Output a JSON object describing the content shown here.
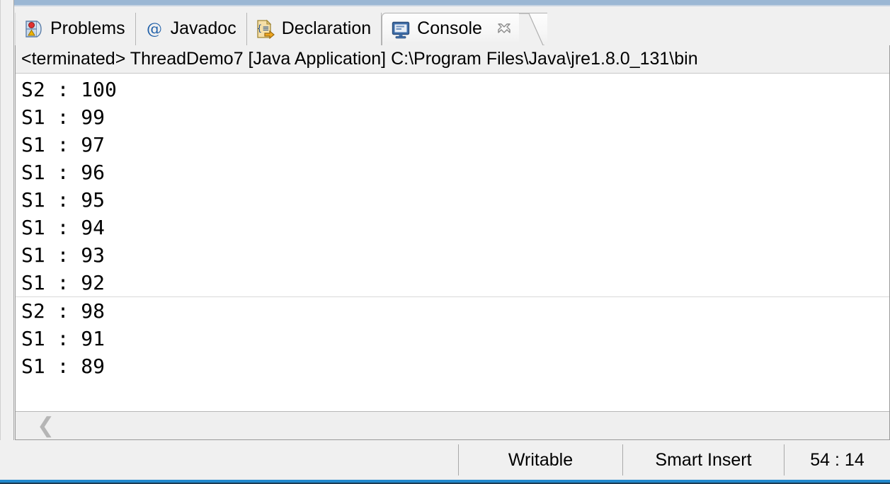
{
  "window": {
    "accent_blue": "#9bb7d4",
    "bottom_accent": "#2288cc",
    "background": "#f0f0f0"
  },
  "tabs": [
    {
      "label": "Problems",
      "icon": "problems-icon",
      "active": false,
      "closable": false
    },
    {
      "label": "Javadoc",
      "icon": "javadoc-icon",
      "active": false,
      "closable": false
    },
    {
      "label": "Declaration",
      "icon": "declaration-icon",
      "active": false,
      "closable": false
    },
    {
      "label": "Console",
      "icon": "console-icon",
      "active": true,
      "closable": true
    }
  ],
  "console": {
    "header": "<terminated> ThreadDemo7 [Java Application] C:\\Program Files\\Java\\jre1.8.0_131\\bin",
    "lines": [
      {
        "text": "S2 : 100",
        "separator_after": false
      },
      {
        "text": "S1 : 99",
        "separator_after": false
      },
      {
        "text": "S1 : 97",
        "separator_after": false
      },
      {
        "text": "S1 : 96",
        "separator_after": false
      },
      {
        "text": "S1 : 95",
        "separator_after": false
      },
      {
        "text": "S1 : 94",
        "separator_after": false
      },
      {
        "text": "S1 : 93",
        "separator_after": false
      },
      {
        "text": "S1 : 92",
        "separator_after": true
      },
      {
        "text": "S2 : 98",
        "separator_after": false
      },
      {
        "text": "S1 : 91",
        "separator_after": false
      },
      {
        "text": "S1 : 89",
        "separator_after": false
      }
    ],
    "scroll_left_glyph": "❮"
  },
  "status_bar": {
    "writable": "Writable",
    "insert_mode": "Smart Insert",
    "position": "54 : 14"
  }
}
